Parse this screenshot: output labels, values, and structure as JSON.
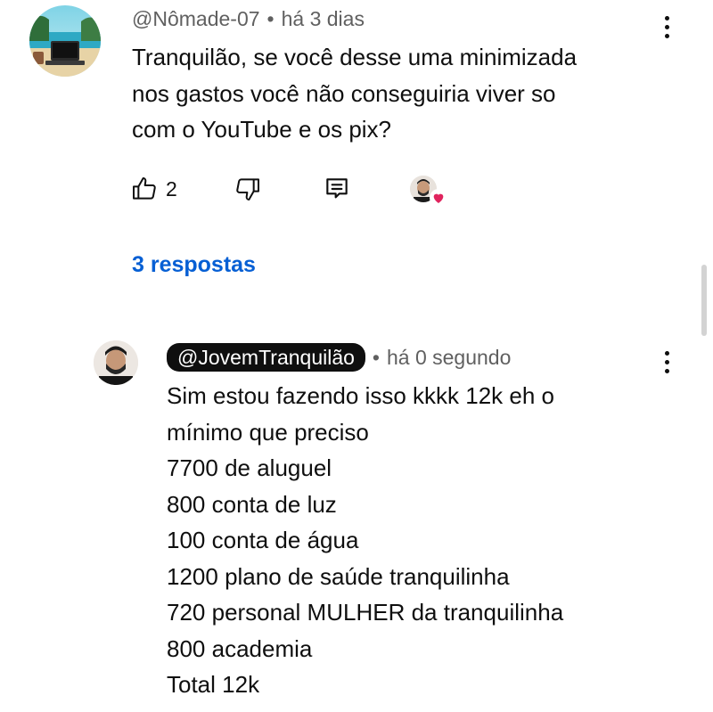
{
  "top_comment": {
    "author": "@Nômade-07",
    "time": "há 3 dias",
    "lines": [
      "Tranquilão,  se você desse uma minimizada",
      "nos gastos você não conseguiria viver so",
      "com o YouTube e os pix?"
    ],
    "like_count": "2",
    "icons": {
      "like": "thumbs-up-icon",
      "dislike": "thumbs-down-icon",
      "reply": "reply-comment-icon",
      "creator_heart": "heart-icon",
      "menu": "more-vertical-icon"
    },
    "replies_label": "3 respostas"
  },
  "reply": {
    "author": "@JovemTranquilão",
    "time": "há 0 segundo",
    "lines": [
      "Sim estou fazendo isso kkkk 12k eh o",
      "mínimo que preciso",
      "7700 de aluguel",
      "800 conta de luz",
      "100 conta de água",
      "1200 plano de saúde tranquilinha",
      "720 personal MULHER da tranquilinha",
      "800 academia",
      "Total 12k"
    ]
  },
  "colors": {
    "link": "#065fd4",
    "meta_text": "#606060",
    "text": "#0f0f0f",
    "pill_bg": "#0f0f0f",
    "heart": "#e0245e"
  }
}
